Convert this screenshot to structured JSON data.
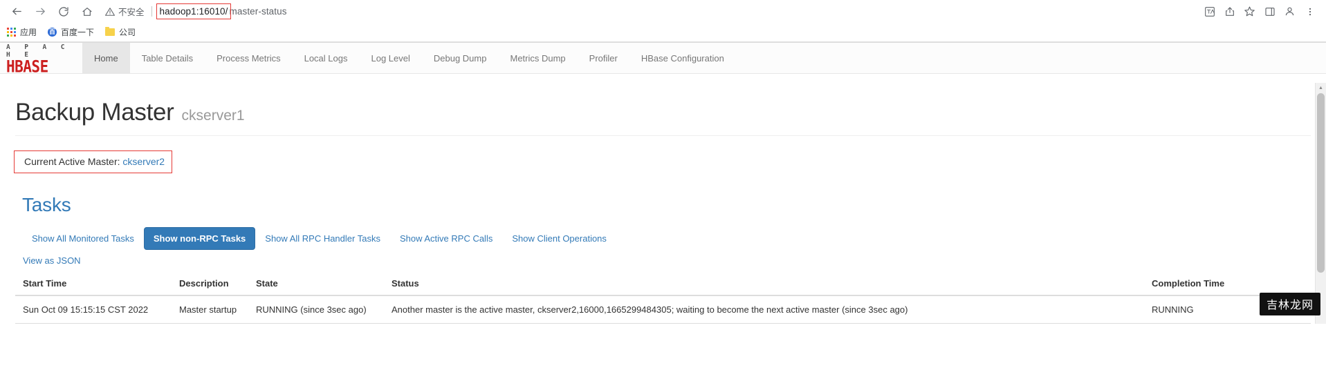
{
  "browser": {
    "nav": {
      "back_icon": "arrow-left-icon",
      "forward_icon": "arrow-right-icon",
      "reload_icon": "reload-icon",
      "home_icon": "home-icon"
    },
    "omnibox": {
      "security_label": "不安全",
      "security_icon": "warning-triangle-icon",
      "url_host": "hadoop1:16010/",
      "url_path": "master-status",
      "highlight_color": "#e53935"
    },
    "toolbar_icons": [
      {
        "name": "translate-icon",
        "glyph": "文"
      },
      {
        "name": "share-icon",
        "glyph": "⇪"
      },
      {
        "name": "bookmark-star-icon",
        "glyph": "☆"
      },
      {
        "name": "sidepanel-icon",
        "glyph": "▯"
      },
      {
        "name": "profile-avatar-icon",
        "glyph": "●"
      },
      {
        "name": "menu-kebab-icon",
        "glyph": "⋮"
      }
    ],
    "bookmarks": [
      {
        "label": "应用",
        "icon": "apps-grid-icon"
      },
      {
        "label": "百度一下",
        "icon": "baidu-icon"
      },
      {
        "label": "公司",
        "icon": "folder-icon"
      }
    ]
  },
  "site": {
    "brand": {
      "top": "A P A C H E",
      "bottom": "HBASE",
      "color": "#cc1f1f"
    },
    "nav_items": [
      {
        "label": "Home",
        "active": true
      },
      {
        "label": "Table Details",
        "active": false
      },
      {
        "label": "Process Metrics",
        "active": false
      },
      {
        "label": "Local Logs",
        "active": false
      },
      {
        "label": "Log Level",
        "active": false
      },
      {
        "label": "Debug Dump",
        "active": false
      },
      {
        "label": "Metrics Dump",
        "active": false
      },
      {
        "label": "Profiler",
        "active": false
      },
      {
        "label": "HBase Configuration",
        "active": false
      }
    ]
  },
  "page": {
    "title": "Backup Master",
    "subtitle": "ckserver1",
    "active_master": {
      "label": "Current Active Master:",
      "link": "ckserver2"
    },
    "tasks": {
      "heading": "Tasks",
      "buttons": [
        {
          "label": "Show All Monitored Tasks",
          "active": false
        },
        {
          "label": "Show non-RPC Tasks",
          "active": true
        },
        {
          "label": "Show All RPC Handler Tasks",
          "active": false
        },
        {
          "label": "Show Active RPC Calls",
          "active": false
        },
        {
          "label": "Show Client Operations",
          "active": false
        }
      ],
      "json_link": "View as JSON",
      "columns": [
        "Start Time",
        "Description",
        "State",
        "Status",
        "Completion Time"
      ],
      "rows": [
        {
          "start_time": "Sun Oct 09 15:15:15 CST 2022",
          "description": "Master startup",
          "state": "RUNNING (since 3sec ago)",
          "status": "Another master is the active master, ckserver2,16000,1665299484305; waiting to become the next active master (since 3sec ago)",
          "completion_time": "RUNNING"
        }
      ]
    }
  },
  "watermark": {
    "text": "吉林龙网"
  }
}
